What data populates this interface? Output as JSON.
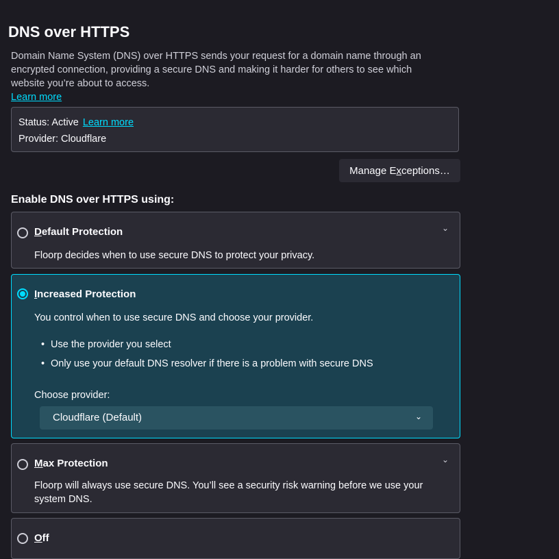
{
  "header": {
    "title": "DNS over HTTPS",
    "description": "Domain Name System (DNS) over HTTPS sends your request for a domain name through an encrypted connection, providing a secure DNS and making it harder for others to see which website you’re about to access.",
    "learn_more": "Learn more"
  },
  "status": {
    "status_text": "Status: Active",
    "learn_more": "Learn more",
    "provider_text": "Provider: Cloudflare"
  },
  "manage_button": {
    "pre": "Manage E",
    "key": "x",
    "post": "ceptions…"
  },
  "section_heading": "Enable DNS over HTTPS using:",
  "options": {
    "default": {
      "title_key": "D",
      "title_rest": "efault Protection",
      "description": "Floorp decides when to use secure DNS to protect your privacy.",
      "selected": false
    },
    "increased": {
      "title_key": "I",
      "title_rest": "ncreased Protection",
      "description": "You control when to use secure DNS and choose your provider.",
      "bullets": [
        "Use the provider you select",
        "Only use your default DNS resolver if there is a problem with secure DNS"
      ],
      "choose_label": "Choose provider:",
      "provider_selected": "Cloudflare (Default)",
      "selected": true
    },
    "max": {
      "title_key": "M",
      "title_rest": "ax Protection",
      "description": "Floorp will always use secure DNS. You’ll see a security risk warning before we use your system DNS.",
      "selected": false
    },
    "off": {
      "title_key": "O",
      "title_rest": "ff",
      "selected": false
    }
  },
  "icons": {
    "expand": "chevron-down-icon",
    "radio": "radio-button"
  },
  "colors": {
    "accent": "#00ddff",
    "background": "#1c1b22",
    "card": "#2b2a33",
    "selected_card": "#1b4150"
  }
}
